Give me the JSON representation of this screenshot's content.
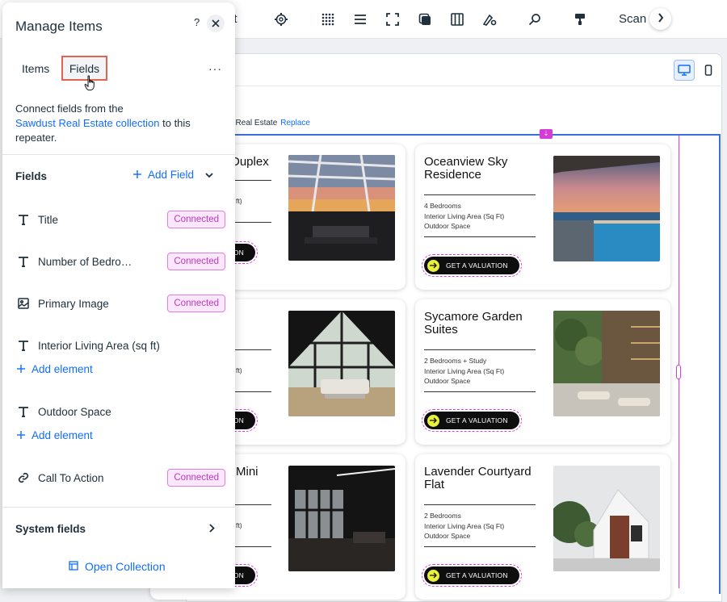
{
  "toolbar": {
    "partial_text": "nt",
    "scan_label": "Scan",
    "icons": [
      "gear-icon",
      "grid-icon",
      "menu-icon",
      "fullscreen-icon",
      "layers-icon",
      "columns-icon",
      "design-icon",
      "search-icon",
      "paint-icon"
    ]
  },
  "canvas": {
    "dataset_label": "t Real Estate",
    "dataset_replace": "Replace",
    "cards": [
      {
        "title": "Duplex",
        "details": [
          "",
          "ft)",
          ""
        ],
        "cta": "ON"
      },
      {
        "title": "Oceanview Sky Residence",
        "details": [
          "4 Bedrooms",
          "Interior Living Area (Sq Ft)",
          "Outdoor Space"
        ],
        "cta": "GET A VALUATION"
      },
      {
        "title": "",
        "details": [
          "",
          "ft)",
          ""
        ],
        "cta": "ON"
      },
      {
        "title": "Sycamore Garden Suites",
        "details": [
          "2 Bedrooms + Study",
          "Interior Living Area (Sq Ft)",
          "Outdoor Space"
        ],
        "cta": "GET A VALUATION"
      },
      {
        "title": "Mini",
        "details": [
          "",
          "ft)",
          ""
        ],
        "cta": "ON"
      },
      {
        "title": "Lavender Courtyard Flat",
        "details": [
          "2 Bedrooms",
          "Interior Living Area (Sq Ft)",
          "Outdoor Space"
        ],
        "cta": "GET A VALUATION"
      }
    ]
  },
  "panel": {
    "title": "Manage Items",
    "help": "?",
    "tabs": {
      "items": "Items",
      "fields": "Fields"
    },
    "connect_prefix": "Connect fields from the",
    "connect_link": "Sawdust Real Estate collection",
    "connect_suffix": "to this repeater.",
    "fields_heading": "Fields",
    "add_field": "Add Field",
    "fields": [
      {
        "label": "Title",
        "icon": "text-icon",
        "status": "Connected"
      },
      {
        "label": "Number of Bedro…",
        "icon": "text-icon",
        "status": "Connected"
      },
      {
        "label": "Primary Image",
        "icon": "image-icon",
        "status": "Connected"
      },
      {
        "label": "Interior Living Area (sq ft)",
        "icon": "text-icon",
        "status": ""
      },
      {
        "label": "Outdoor Space",
        "icon": "text-icon",
        "status": ""
      },
      {
        "label": "Call To Action",
        "icon": "link-icon",
        "status": "Connected"
      }
    ],
    "add_element": "Add element",
    "system_fields": "System fields",
    "open_collection": "Open Collection"
  },
  "colors": {
    "accent": "#116dff",
    "connected": "#c236c2",
    "highlight": "#e0644f"
  }
}
